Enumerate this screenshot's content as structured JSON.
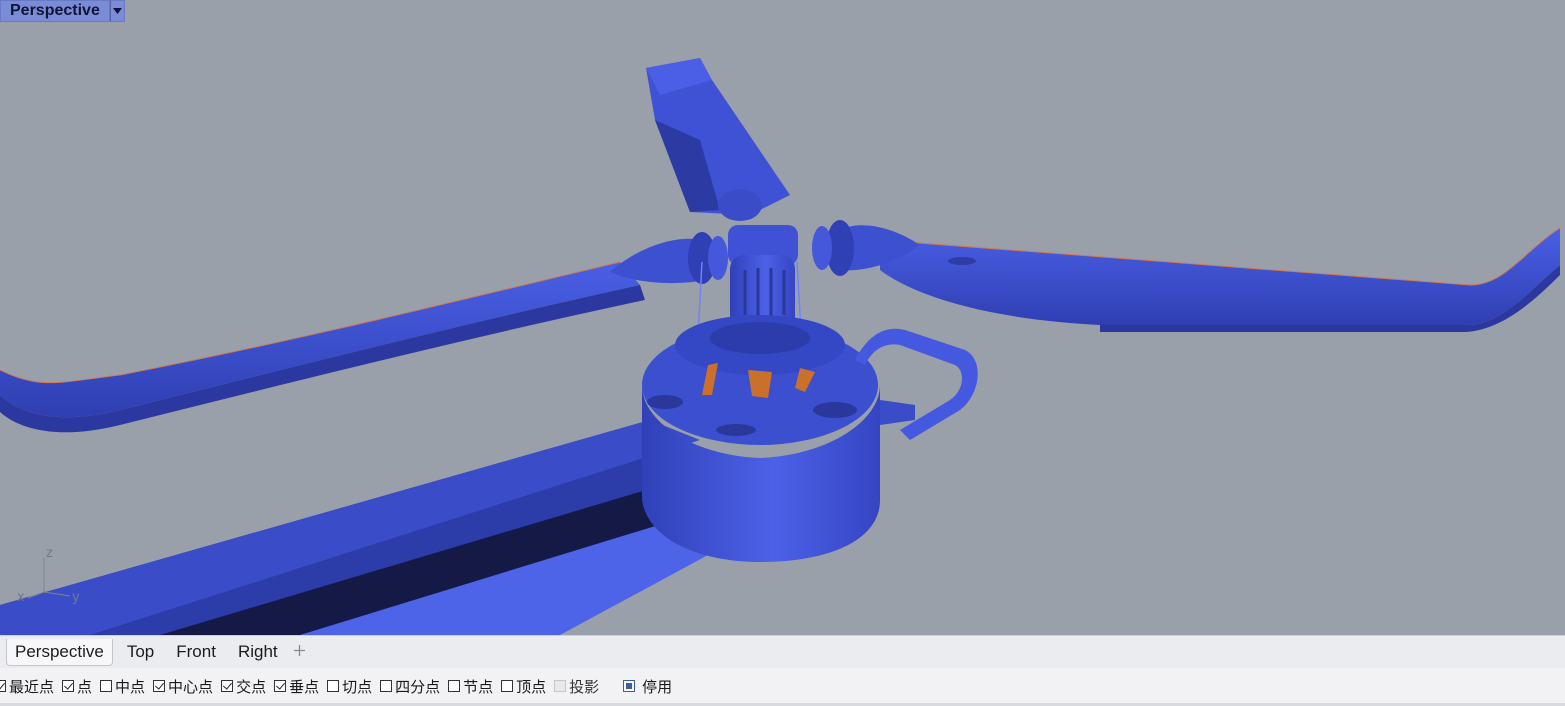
{
  "viewport": {
    "title": "Perspective",
    "dropdown_icon": "triangle-down-icon",
    "background": "#99a0aa",
    "model_color": "#3f52d6",
    "axis": {
      "x": "x",
      "y": "y",
      "z": "z"
    }
  },
  "tabs": [
    {
      "label": "Perspective",
      "active": true
    },
    {
      "label": "Top",
      "active": false
    },
    {
      "label": "Front",
      "active": false
    },
    {
      "label": "Right",
      "active": false
    }
  ],
  "tab_add_icon": "plus-icon",
  "osnap": [
    {
      "label": "最近点",
      "checked": true
    },
    {
      "label": "点",
      "checked": true
    },
    {
      "label": "中点",
      "checked": false
    },
    {
      "label": "中心点",
      "checked": true
    },
    {
      "label": "交点",
      "checked": true
    },
    {
      "label": "垂点",
      "checked": true
    },
    {
      "label": "切点",
      "checked": false
    },
    {
      "label": "四分点",
      "checked": false
    },
    {
      "label": "节点",
      "checked": false
    },
    {
      "label": "顶点",
      "checked": false
    },
    {
      "label": "投影",
      "checked": false,
      "disabled": true
    },
    {
      "label": "停用",
      "checked": "partial"
    }
  ]
}
